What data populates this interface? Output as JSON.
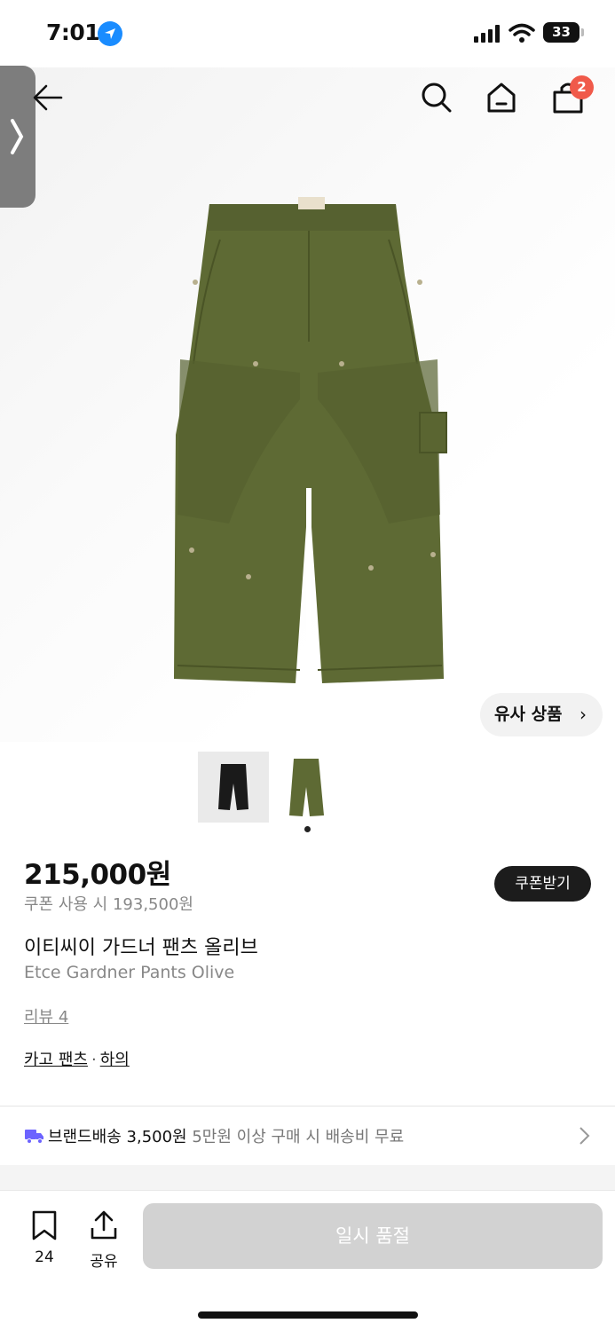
{
  "status_bar": {
    "time": "7:01",
    "battery": "33"
  },
  "header": {
    "cart_count": "2"
  },
  "similar_button": {
    "label": "유사 상품",
    "chevron": "›"
  },
  "gallery": {
    "thumbnails": [
      "black-pants",
      "olive-pants"
    ],
    "active_index": 1
  },
  "product": {
    "price": "215,000원",
    "coupon_price": "쿠폰 사용 시 193,500원",
    "coupon_button": "쿠폰받기",
    "name_ko": "이티씨이 가드너 팬츠 올리브",
    "name_en": "Etce Gardner Pants Olive",
    "review_link": "리뷰 4",
    "category_1": "카고 팬츠",
    "category_sep": "·",
    "category_2": "하의"
  },
  "shipping": {
    "label": "브랜드배송 3,500원",
    "note": "5만원 이상 구매 시 배송비 무료"
  },
  "bottom_bar": {
    "bookmark_count": "24",
    "share_label": "공유",
    "soldout_label": "일시 품절"
  },
  "colors": {
    "accent_badge": "#f05a4a",
    "button_dark": "#1c1c1c",
    "disabled": "#d2d2d2",
    "truck": "#6c63ff"
  }
}
